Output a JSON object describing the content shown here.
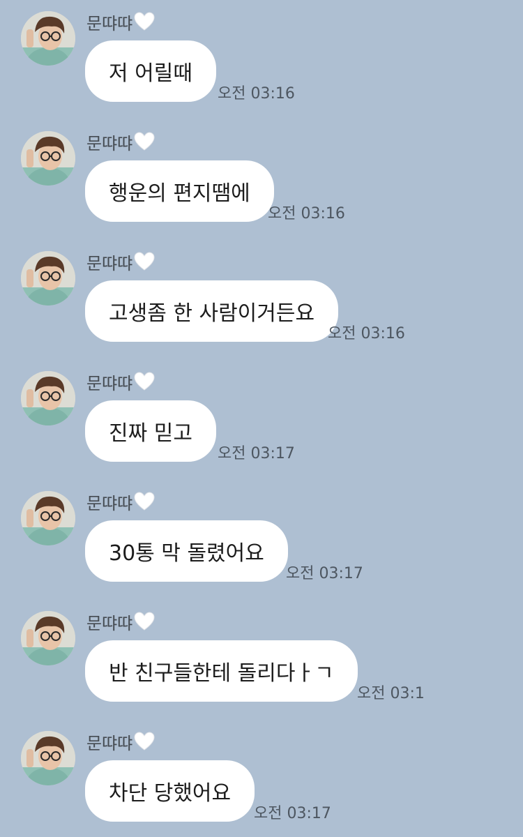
{
  "chat": {
    "background_color": "#aebfd2",
    "bubble_color": "#ffffff",
    "messages": [
      {
        "sender": "문땨땨",
        "sender_icon": "white-heart-icon",
        "text": "저 어릴때",
        "time": "오전 03:16"
      },
      {
        "sender": "문땨땨",
        "sender_icon": "white-heart-icon",
        "text": "행운의 편지땜에",
        "time": "오전 03:16"
      },
      {
        "sender": "문땨땨",
        "sender_icon": "white-heart-icon",
        "text": "고생좀 한 사람이거든요",
        "time": "오전 03:16"
      },
      {
        "sender": "문땨땨",
        "sender_icon": "white-heart-icon",
        "text": "진짜 믿고",
        "time": "오전 03:17"
      },
      {
        "sender": "문땨땨",
        "sender_icon": "white-heart-icon",
        "text": "30통 막 돌렸어요",
        "time": "오전 03:17"
      },
      {
        "sender": "문땨땨",
        "sender_icon": "white-heart-icon",
        "text": "반 친구들한테 돌리다ㅏㄱ",
        "time": "오전 03:1"
      },
      {
        "sender": "문땨땨",
        "sender_icon": "white-heart-icon",
        "text": "차단 당했어요",
        "time": "오전 03:17"
      }
    ]
  }
}
